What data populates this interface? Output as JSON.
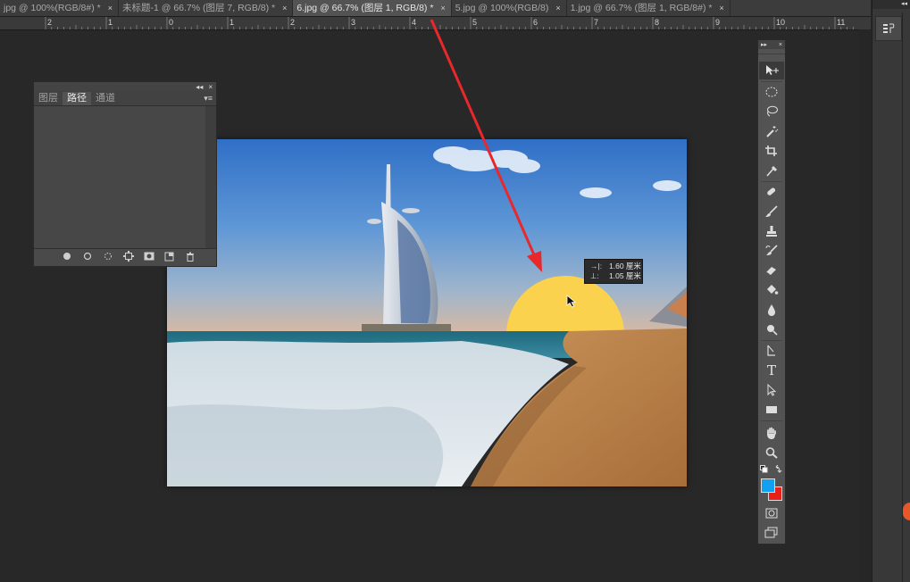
{
  "tabs": [
    {
      "label": "jpg @ 100%(RGB/8#) *",
      "active": false
    },
    {
      "label": "未标题-1 @ 66.7% (图层 7, RGB/8) *",
      "active": false
    },
    {
      "label": "6.jpg @ 66.7% (图层 1, RGB/8) *",
      "active": true
    },
    {
      "label": "5.jpg @ 100%(RGB/8)",
      "active": false
    },
    {
      "label": "1.jpg @ 66.7% (图层 1, RGB/8#) *",
      "active": false
    }
  ],
  "tab_close_glyph": "×",
  "ruler": {
    "labels": [
      "2",
      "1",
      "0",
      "1",
      "2",
      "3",
      "4",
      "5",
      "6",
      "7",
      "8",
      "9",
      "10",
      "11"
    ]
  },
  "paths_panel": {
    "collapse_glyph": "◂◂",
    "close_glyph": "×",
    "tabs": [
      "图层",
      "路径",
      "通道"
    ],
    "active_tab": "路径",
    "menu_glyph": "▾≡"
  },
  "tooltip": {
    "width_icon": "→|:",
    "width_value": "1.60 厘米",
    "height_icon": "⊥:",
    "height_value": "1.05 厘米"
  },
  "toolbar": {
    "collapse_glyph": "▸▸",
    "close_glyph": "×",
    "text_tool_glyph": "T"
  },
  "colors": {
    "foreground": "#12a0f0",
    "background": "#e8201a",
    "annotation_arrow": "#e8282a",
    "sun_fill": "#fbd24e"
  },
  "right_dock": {
    "collapse_glyph": "◂◂"
  }
}
